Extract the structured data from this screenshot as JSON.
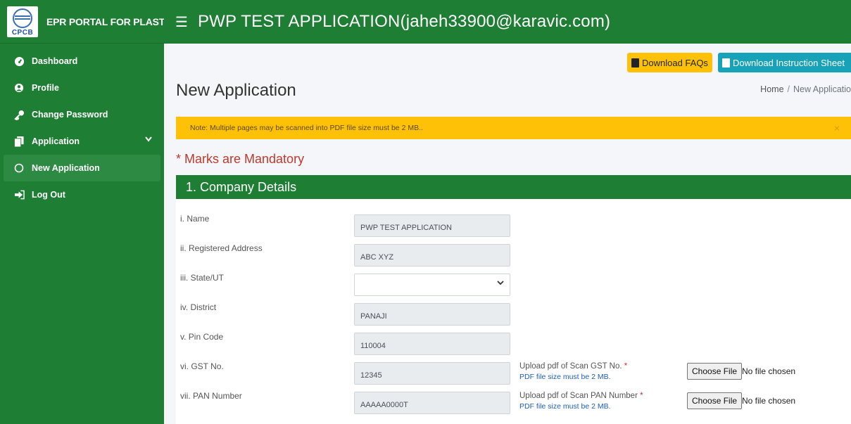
{
  "brand": {
    "logo_text": "CPCB",
    "title": "EPR PORTAL FOR PLASTIC"
  },
  "topbar": {
    "title": "PWP TEST APPLICATION(jaheh33900@karavic.com)"
  },
  "sidebar": {
    "items": [
      {
        "label": "Dashboard",
        "icon": "dashboard-icon"
      },
      {
        "label": "Profile",
        "icon": "user-icon"
      },
      {
        "label": "Change Password",
        "icon": "key-icon"
      },
      {
        "label": "Application",
        "icon": "copy-icon"
      },
      {
        "label": "New Application",
        "icon": "circle-icon"
      },
      {
        "label": "Log Out",
        "icon": "logout-icon"
      }
    ]
  },
  "actions": {
    "faq": "Download FAQs",
    "sheet": "Download Instruction Sheet"
  },
  "page": {
    "title": "New Application",
    "breadcrumb_home": "Home",
    "breadcrumb_sep": "/",
    "breadcrumb_current": "New Applicatio"
  },
  "alert": {
    "text": "Note: Multiple pages may be scanned into PDF file size must be 2 MB..",
    "close": "×"
  },
  "mandatory": "* Marks are Mandatory",
  "section": {
    "title": "1. Company Details"
  },
  "form": {
    "name_label": "i. Name",
    "name_value": "PWP TEST APPLICATION",
    "address_label": "ii. Registered Address",
    "address_value": "ABC XYZ",
    "state_label": "iii. State/UT",
    "state_value": "",
    "district_label": "iv. District",
    "district_value": "PANAJI",
    "pin_label": "v. Pin Code",
    "pin_value": "110004",
    "gst_label": "vi. GST No.",
    "gst_value": "12345",
    "gst_upload_label": "Upload pdf of Scan GST No.",
    "pan_label": "vii. PAN Number",
    "pan_value": "AAAAA0000T",
    "pan_upload_label": "Upload pdf of Scan PAN Number",
    "upload_note": "PDF file size must be 2 MB.",
    "required_mark": "*",
    "choose_file": "Choose File",
    "no_file": "No file chosen"
  },
  "colors": {
    "primary_green": "#1e7e34",
    "warning": "#ffc107",
    "info": "#17a2b8",
    "required": "#c0392b"
  }
}
